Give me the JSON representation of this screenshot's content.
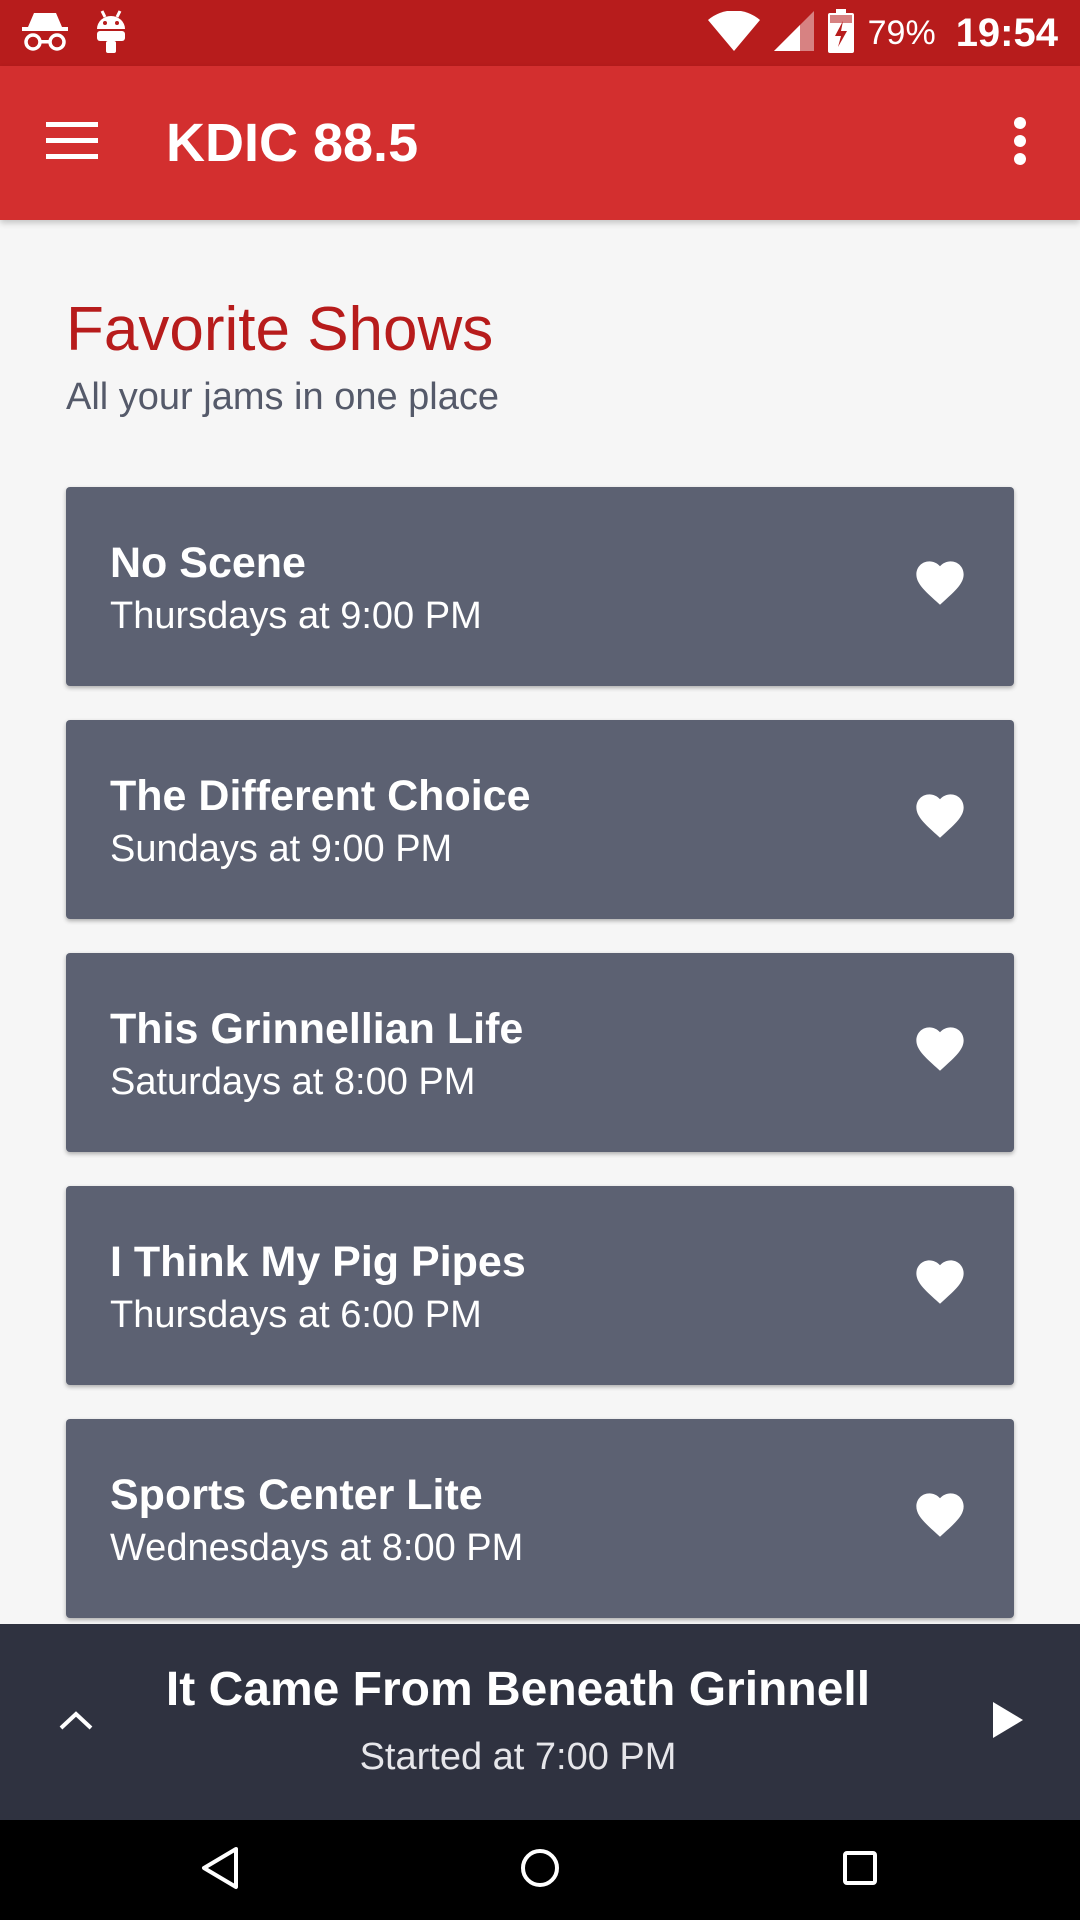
{
  "status_bar": {
    "battery": "79%",
    "time": "19:54",
    "icons": [
      "incognito-icon",
      "android-debug-icon",
      "wifi-icon",
      "cell-signal-icon",
      "battery-charging-icon"
    ]
  },
  "app_bar": {
    "title": "KDIC 88.5",
    "menu_icon": "hamburger-menu-icon",
    "overflow_icon": "more-vert-icon"
  },
  "section": {
    "title": "Favorite Shows",
    "subtitle": "All your jams in one place"
  },
  "shows": [
    {
      "name": "No Scene",
      "time": "Thursdays at 9:00 PM"
    },
    {
      "name": "The Different Choice",
      "time": "Sundays at 9:00 PM"
    },
    {
      "name": "This Grinnellian Life",
      "time": "Saturdays at 8:00 PM"
    },
    {
      "name": "I Think My Pig Pipes",
      "time": "Thursdays at 6:00 PM"
    },
    {
      "name": "Sports Center Lite",
      "time": "Wednesdays at 8:00 PM"
    }
  ],
  "now_playing": {
    "title": "It Came From Beneath Grinnell",
    "subtitle": "Started at 7:00 PM"
  },
  "colors": {
    "status_bar": "#b71c1c",
    "app_bar": "#d32f2f",
    "accent_text": "#b71c1c",
    "card": "#5c6172",
    "player": "#2f3240",
    "background": "#f6f6f6"
  }
}
